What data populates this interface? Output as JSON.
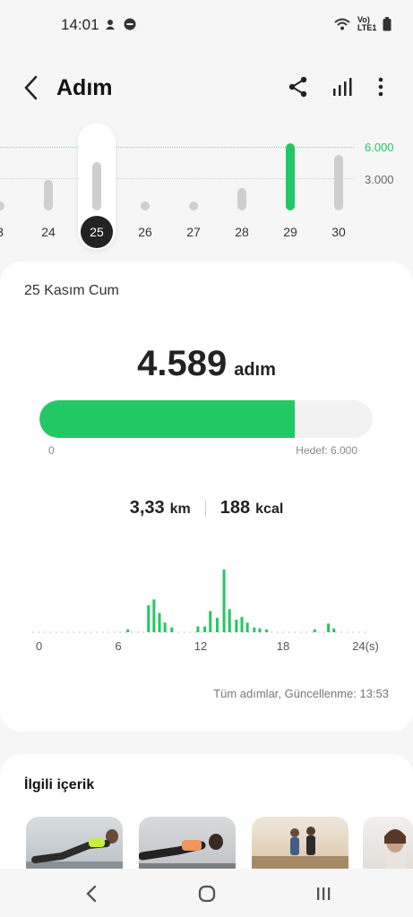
{
  "status_bar": {
    "time": "14:01",
    "network": "Vo) LTE1"
  },
  "header": {
    "title": "Adım"
  },
  "week_chart": {
    "goal_label": "6.000",
    "mid_label": "3.000",
    "selected_day": "25",
    "days": [
      {
        "label": "3",
        "steps": 400
      },
      {
        "label": "24",
        "steps": 2900
      },
      {
        "label": "25",
        "steps": 4589
      },
      {
        "label": "26",
        "steps": 300
      },
      {
        "label": "27",
        "steps": 400
      },
      {
        "label": "28",
        "steps": 2100
      },
      {
        "label": "29",
        "steps": 6300
      },
      {
        "label": "30",
        "steps": 5200
      }
    ]
  },
  "summary": {
    "date": "25 Kasım Cum",
    "steps": "4.589",
    "steps_unit": "adım",
    "progress_fraction": 0.765,
    "zero_label": "0",
    "goal_label": "Hedef: 6.000",
    "distance": "3,33",
    "distance_unit": "km",
    "calories": "188",
    "calories_unit": "kcal",
    "updated": "Tüm adımlar, Güncellenme: 13:53"
  },
  "chart_data": {
    "type": "bar",
    "xlabel": "",
    "x_ticks": [
      "0",
      "6",
      "12",
      "18",
      "24(s)"
    ],
    "xlim": [
      0,
      24
    ],
    "values": [
      {
        "t": 6.7,
        "v": 3
      },
      {
        "t": 8.2,
        "v": 28
      },
      {
        "t": 8.6,
        "v": 34
      },
      {
        "t": 9.0,
        "v": 20
      },
      {
        "t": 9.4,
        "v": 10
      },
      {
        "t": 9.9,
        "v": 5
      },
      {
        "t": 11.8,
        "v": 6
      },
      {
        "t": 12.3,
        "v": 6
      },
      {
        "t": 12.7,
        "v": 22
      },
      {
        "t": 13.2,
        "v": 15
      },
      {
        "t": 13.7,
        "v": 65
      },
      {
        "t": 14.1,
        "v": 24
      },
      {
        "t": 14.6,
        "v": 13
      },
      {
        "t": 15.0,
        "v": 16
      },
      {
        "t": 15.4,
        "v": 10
      },
      {
        "t": 15.9,
        "v": 5
      },
      {
        "t": 16.3,
        "v": 4
      },
      {
        "t": 16.8,
        "v": 3
      },
      {
        "t": 20.3,
        "v": 3
      },
      {
        "t": 21.3,
        "v": 9
      },
      {
        "t": 21.7,
        "v": 4
      }
    ]
  },
  "related": {
    "title": "İlgili içerik",
    "items": [
      "plank-workout",
      "forearm-plank",
      "running-couple",
      "woman-portrait"
    ]
  },
  "colors": {
    "accent": "#21c863",
    "bar_gray": "#cfcfcf"
  }
}
